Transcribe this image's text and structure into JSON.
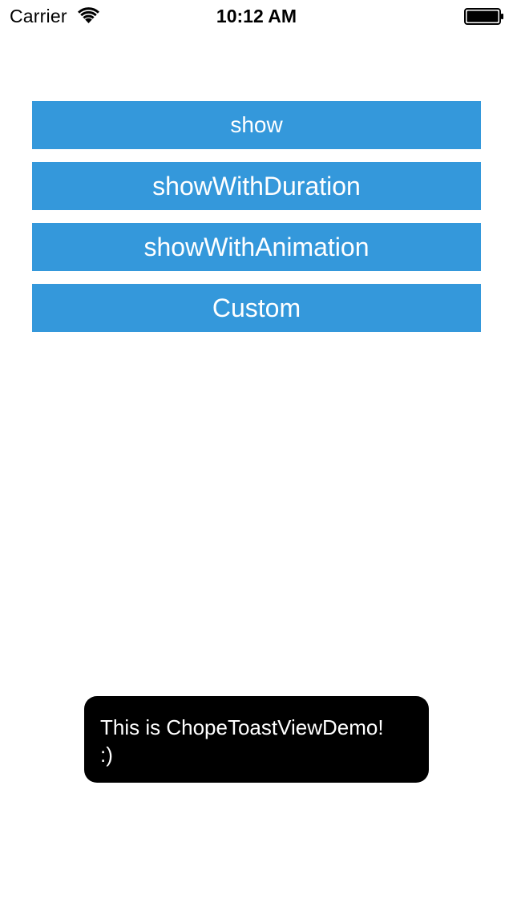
{
  "status_bar": {
    "carrier": "Carrier",
    "time": "10:12 AM",
    "wifi_icon": "wifi-icon",
    "battery_icon": "battery-icon"
  },
  "buttons": [
    {
      "label": "show"
    },
    {
      "label": "showWithDuration"
    },
    {
      "label": "showWithAnimation"
    },
    {
      "label": "Custom"
    }
  ],
  "toast": {
    "line1": "This is ChopeToastViewDemo!",
    "line2": ":)"
  },
  "colors": {
    "button_bg": "#3498db",
    "button_text": "#ffffff",
    "toast_bg": "#000000",
    "toast_text": "#ffffff",
    "background": "#ffffff"
  }
}
